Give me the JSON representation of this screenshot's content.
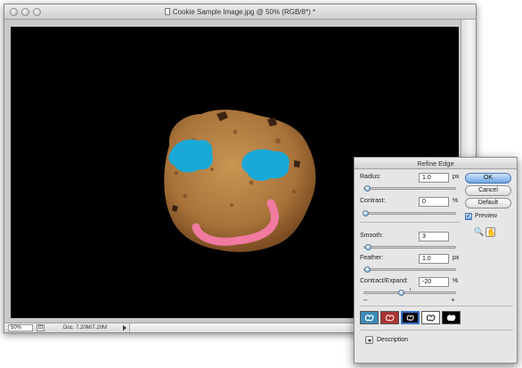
{
  "document": {
    "title": "Cookie Sample Image.jpg @ 50% (RGB/8*) *",
    "zoom": "50%",
    "doc_size": "Doc: 7.20M/7.20M"
  },
  "dialog": {
    "title": "Refine Edge",
    "fields": {
      "radius": {
        "label": "Radius:",
        "value": "1.0",
        "unit": "px"
      },
      "contrast": {
        "label": "Contrast:",
        "value": "0",
        "unit": "%"
      },
      "smooth": {
        "label": "Smooth:",
        "value": "3"
      },
      "feather": {
        "label": "Feather:",
        "value": "1.0",
        "unit": "px"
      },
      "contract": {
        "label": "Contract/Expand:",
        "value": "-20",
        "unit": "%",
        "minus": "–",
        "plus": "+"
      }
    },
    "buttons": {
      "ok": "OK",
      "cancel": "Cancel",
      "default": "Default"
    },
    "preview": {
      "label": "Preview",
      "checked": true,
      "checkmark": "✓"
    },
    "tools": {
      "zoom_icon": "🔍",
      "hand_icon": "✋"
    },
    "view_modes": [
      "standard",
      "quick-mask",
      "on-black",
      "on-white",
      "mask"
    ],
    "selected_view_mode": "on-black",
    "description": "Description"
  },
  "colors": {
    "icing_blue": "#1aa8d8",
    "icing_pink": "#f07aa0",
    "ok_button": "#6aa4e6"
  }
}
